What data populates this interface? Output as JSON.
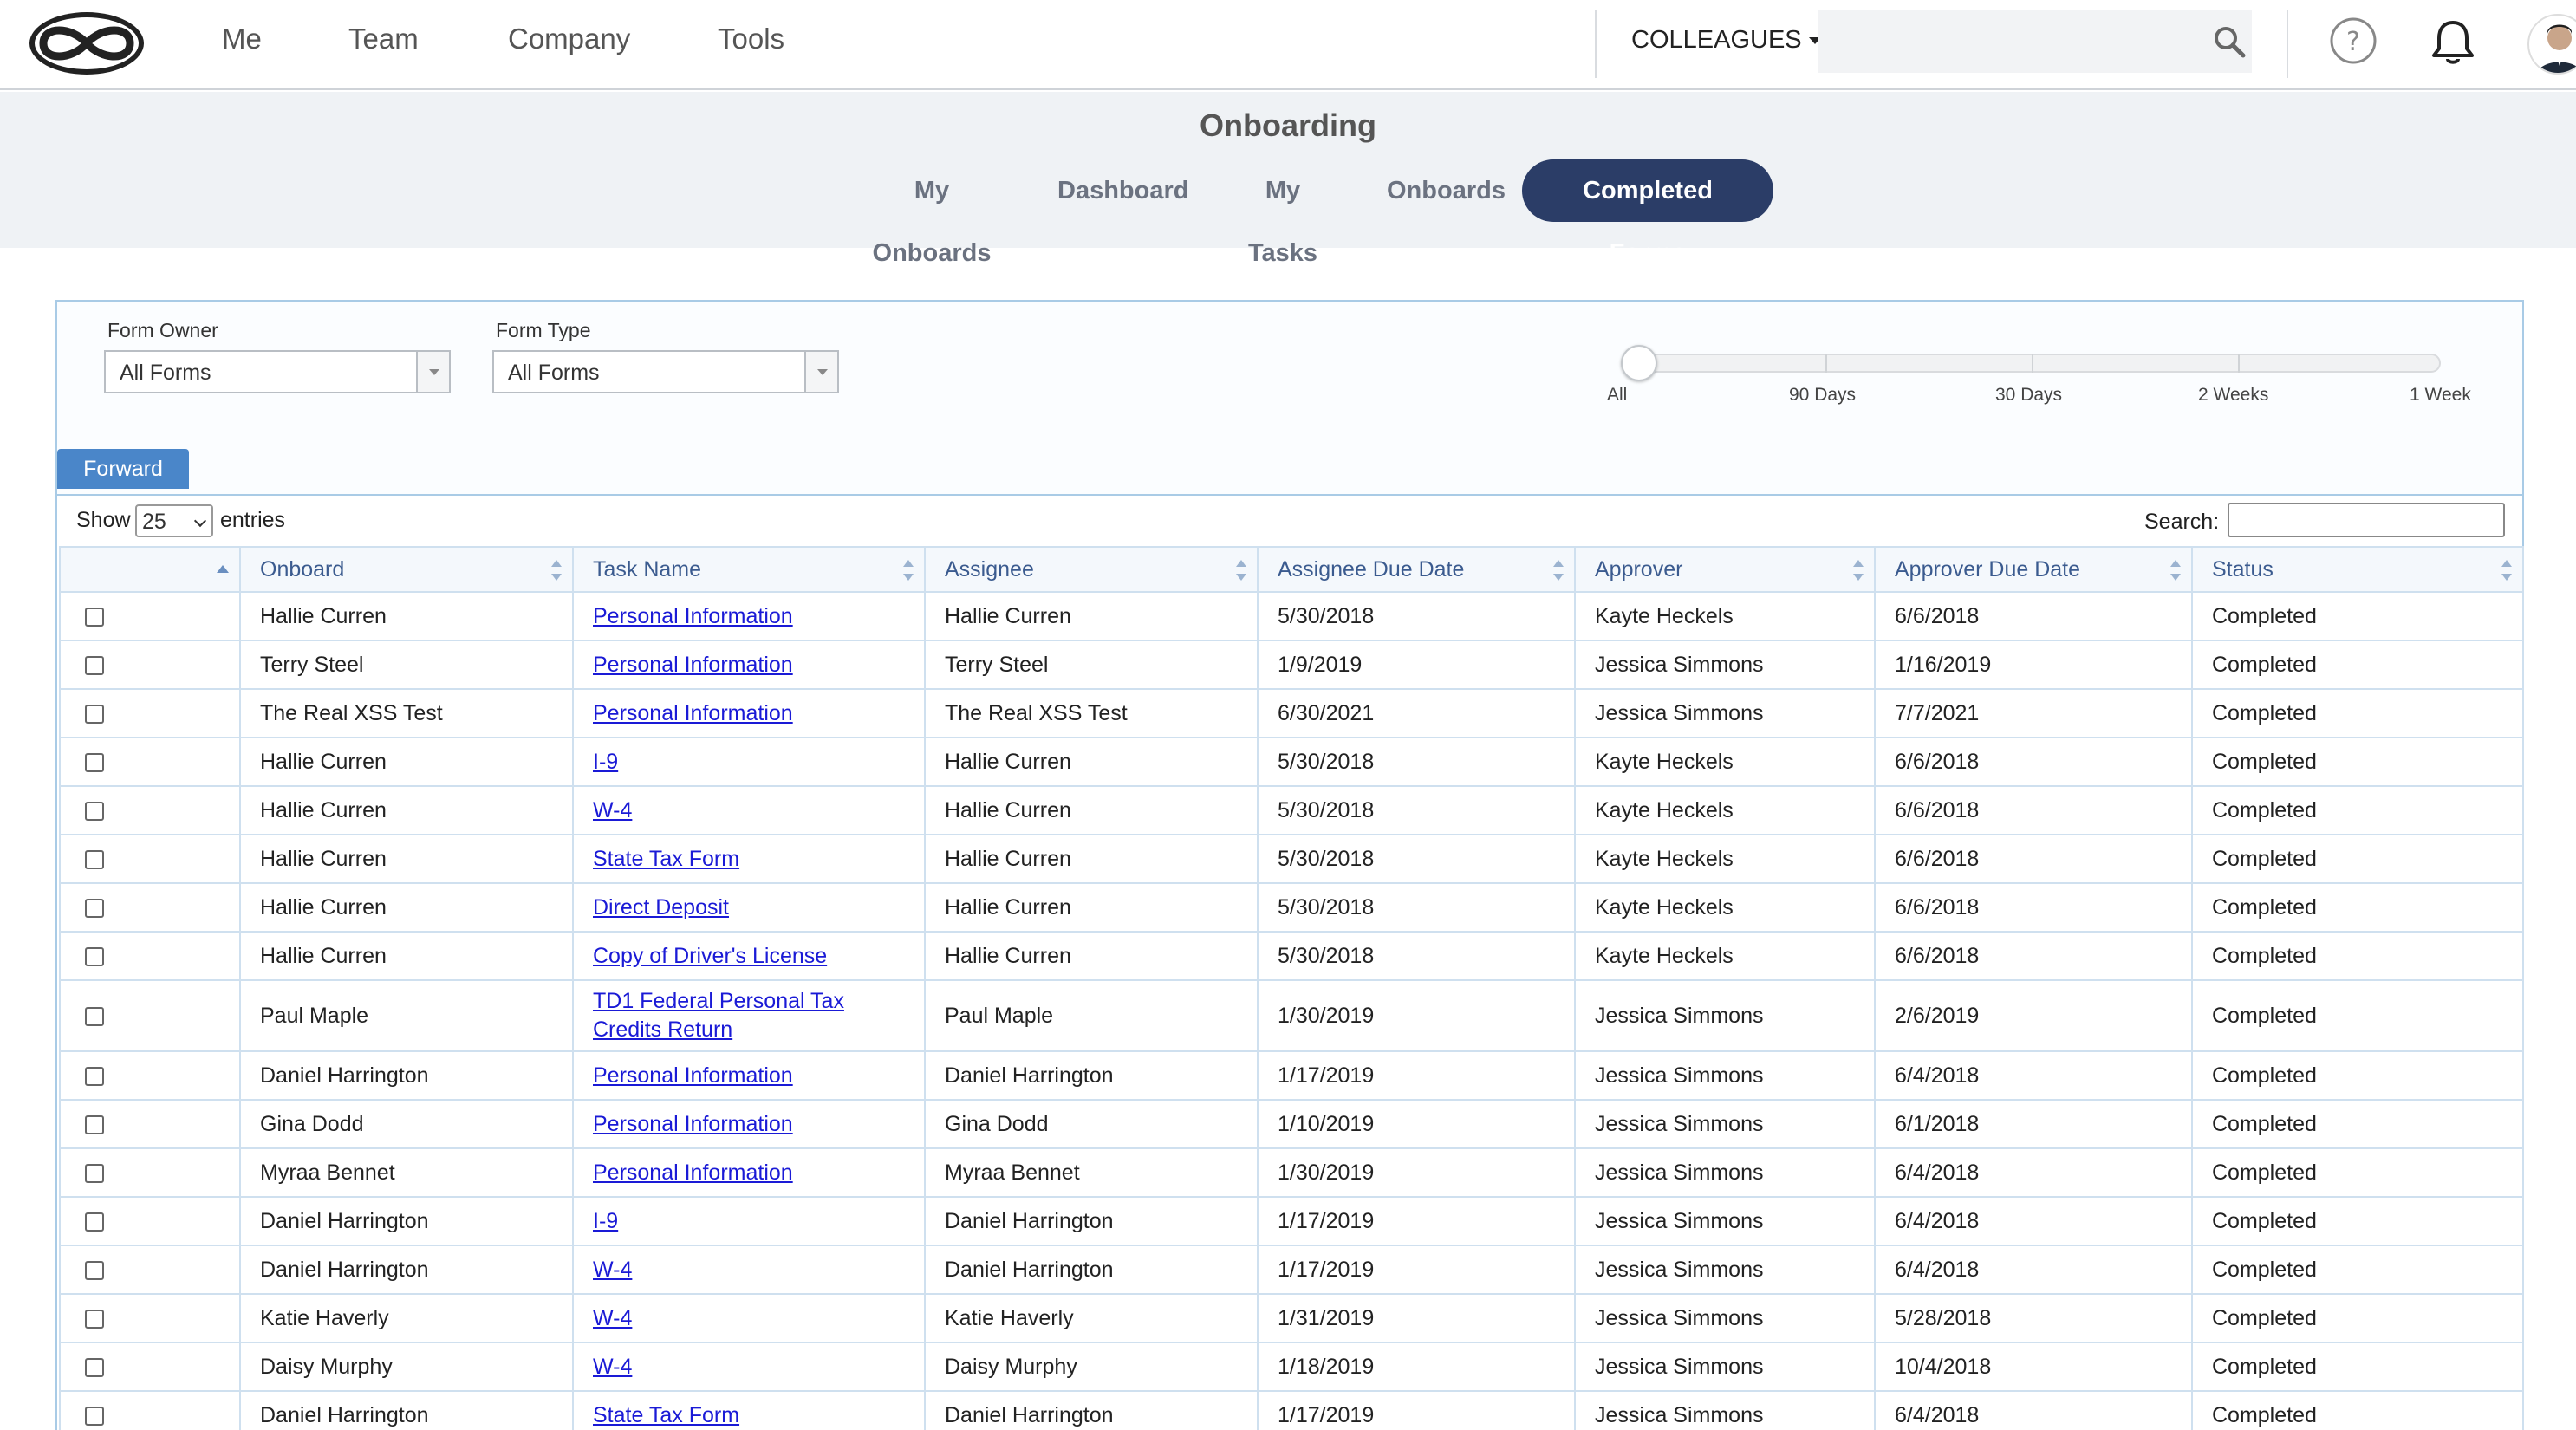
{
  "nav": {
    "logo_icon": "infinity-logo-icon",
    "links": [
      "Me",
      "Team",
      "Company",
      "Tools"
    ],
    "colleagues_label": "COLLEAGUES",
    "search_placeholder": ""
  },
  "header": {
    "title": "Onboarding",
    "tabs": [
      {
        "label": "My Onboards",
        "active": false
      },
      {
        "label": "Dashboard",
        "active": false
      },
      {
        "label": "My Tasks",
        "active": false
      },
      {
        "label": "Onboards",
        "active": false
      },
      {
        "label": "Completed Forms",
        "active": true
      }
    ]
  },
  "filters": {
    "form_owner_label": "Form Owner",
    "form_owner_value": "All Forms",
    "form_type_label": "Form Type",
    "form_type_value": "All Forms",
    "range_labels": [
      "All",
      "90 Days",
      "30 Days",
      "2 Weeks",
      "1 Week"
    ],
    "range_selected": "All"
  },
  "forward_label": "Forward",
  "table": {
    "show_label": "Show",
    "show_value": "25",
    "entries_label": "entries",
    "search_label": "Search:",
    "columns": [
      "",
      "Onboard",
      "Task Name",
      "Assignee",
      "Assignee Due Date",
      "Approver",
      "Approver Due Date",
      "Status"
    ],
    "rows": [
      {
        "onboard": "Hallie Curren",
        "task": "Personal Information",
        "assignee": "Hallie Curren",
        "assignee_due": "5/30/2018",
        "approver": "Kayte Heckels",
        "approver_due": "6/6/2018",
        "status": "Completed"
      },
      {
        "onboard": "Terry Steel",
        "task": "Personal Information",
        "assignee": "Terry Steel",
        "assignee_due": "1/9/2019",
        "approver": "Jessica Simmons",
        "approver_due": "1/16/2019",
        "status": "Completed"
      },
      {
        "onboard": "The Real XSS Test",
        "task": "Personal Information",
        "assignee": "The Real XSS Test",
        "assignee_due": "6/30/2021",
        "approver": "Jessica Simmons",
        "approver_due": "7/7/2021",
        "status": "Completed"
      },
      {
        "onboard": "Hallie Curren",
        "task": "I-9",
        "assignee": "Hallie Curren",
        "assignee_due": "5/30/2018",
        "approver": "Kayte Heckels",
        "approver_due": "6/6/2018",
        "status": "Completed"
      },
      {
        "onboard": "Hallie Curren",
        "task": "W-4",
        "assignee": "Hallie Curren",
        "assignee_due": "5/30/2018",
        "approver": "Kayte Heckels",
        "approver_due": "6/6/2018",
        "status": "Completed"
      },
      {
        "onboard": "Hallie Curren",
        "task": "State Tax Form",
        "assignee": "Hallie Curren",
        "assignee_due": "5/30/2018",
        "approver": "Kayte Heckels",
        "approver_due": "6/6/2018",
        "status": "Completed"
      },
      {
        "onboard": "Hallie Curren",
        "task": "Direct Deposit",
        "assignee": "Hallie Curren",
        "assignee_due": "5/30/2018",
        "approver": "Kayte Heckels",
        "approver_due": "6/6/2018",
        "status": "Completed"
      },
      {
        "onboard": "Hallie Curren",
        "task": "Copy of Driver's License",
        "assignee": "Hallie Curren",
        "assignee_due": "5/30/2018",
        "approver": "Kayte Heckels",
        "approver_due": "6/6/2018",
        "status": "Completed"
      },
      {
        "onboard": "Paul Maple",
        "task": "TD1 Federal Personal Tax Credits Return",
        "assignee": "Paul Maple",
        "assignee_due": "1/30/2019",
        "approver": "Jessica Simmons",
        "approver_due": "2/6/2019",
        "status": "Completed"
      },
      {
        "onboard": "Daniel Harrington",
        "task": "Personal Information",
        "assignee": "Daniel Harrington",
        "assignee_due": "1/17/2019",
        "approver": "Jessica Simmons",
        "approver_due": "6/4/2018",
        "status": "Completed"
      },
      {
        "onboard": "Gina Dodd",
        "task": "Personal Information",
        "assignee": "Gina Dodd",
        "assignee_due": "1/10/2019",
        "approver": "Jessica Simmons",
        "approver_due": "6/1/2018",
        "status": "Completed"
      },
      {
        "onboard": "Myraa Bennet",
        "task": "Personal Information",
        "assignee": "Myraa Bennet",
        "assignee_due": "1/30/2019",
        "approver": "Jessica Simmons",
        "approver_due": "6/4/2018",
        "status": "Completed"
      },
      {
        "onboard": "Daniel Harrington",
        "task": "I-9",
        "assignee": "Daniel Harrington",
        "assignee_due": "1/17/2019",
        "approver": "Jessica Simmons",
        "approver_due": "6/4/2018",
        "status": "Completed"
      },
      {
        "onboard": "Daniel Harrington",
        "task": "W-4",
        "assignee": "Daniel Harrington",
        "assignee_due": "1/17/2019",
        "approver": "Jessica Simmons",
        "approver_due": "6/4/2018",
        "status": "Completed"
      },
      {
        "onboard": "Katie Haverly",
        "task": "W-4",
        "assignee": "Katie Haverly",
        "assignee_due": "1/31/2019",
        "approver": "Jessica Simmons",
        "approver_due": "5/28/2018",
        "status": "Completed"
      },
      {
        "onboard": "Daisy Murphy",
        "task": "W-4",
        "assignee": "Daisy Murphy",
        "assignee_due": "1/18/2019",
        "approver": "Jessica Simmons",
        "approver_due": "10/4/2018",
        "status": "Completed"
      },
      {
        "onboard": "Daniel Harrington",
        "task": "State Tax Form",
        "assignee": "Daniel Harrington",
        "assignee_due": "1/17/2019",
        "approver": "Jessica Simmons",
        "approver_due": "6/4/2018",
        "status": "Completed"
      }
    ]
  },
  "colors": {
    "accent": "#2b3d67",
    "button": "#4a86c9",
    "link": "#1a1ad6",
    "header_text": "#3b5b8f"
  }
}
